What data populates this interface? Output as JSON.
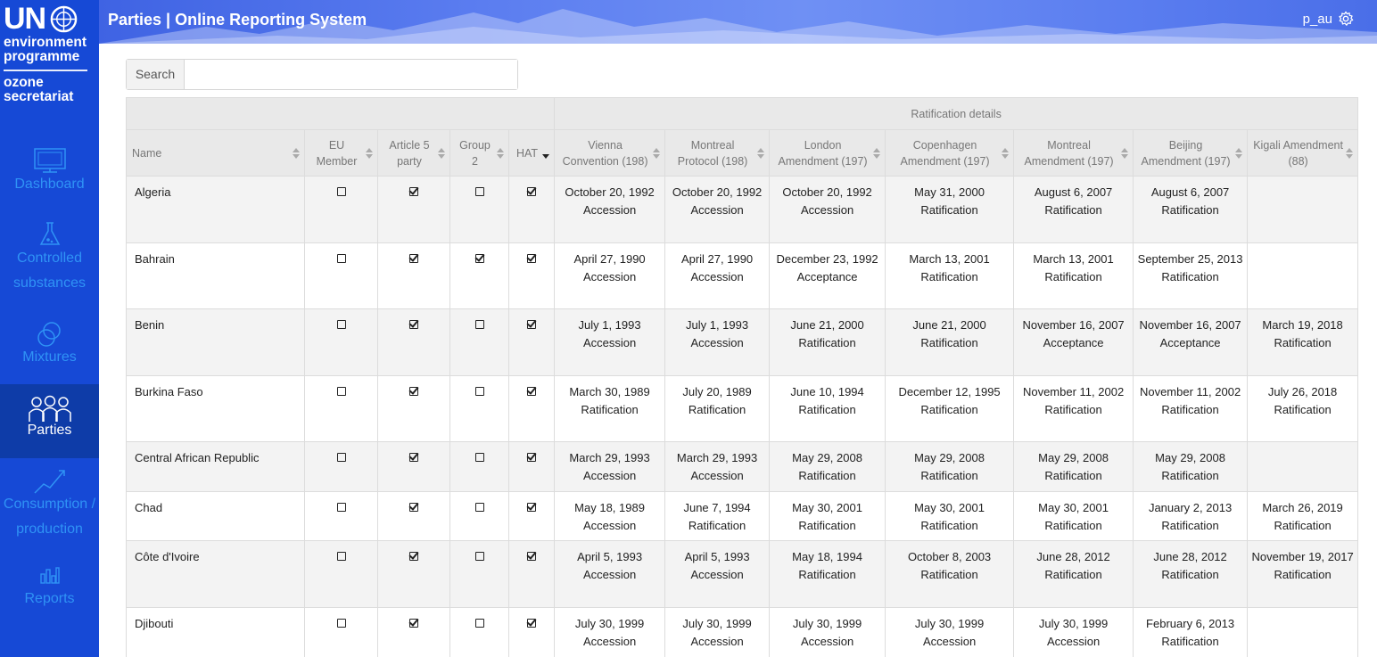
{
  "app": {
    "title": "Parties | Online Reporting System",
    "user": "p_au"
  },
  "logo": {
    "un": "UN",
    "line1": "environment",
    "line2": "programme",
    "line3": "ozone",
    "line4": "secretariat"
  },
  "sidebar": {
    "items": [
      {
        "label": "Dashboard",
        "icon": "monitor-icon",
        "active": false
      },
      {
        "label": "Controlled substances",
        "icon": "flask-icon",
        "active": false
      },
      {
        "label": "Mixtures",
        "icon": "circles-icon",
        "active": false
      },
      {
        "label": "Parties",
        "icon": "people-icon",
        "active": true
      },
      {
        "label": "Consumption / production",
        "icon": "line-chart-icon",
        "active": false
      },
      {
        "label": "Reports",
        "icon": "bar-chart-icon",
        "active": false
      }
    ]
  },
  "search": {
    "label": "Search",
    "value": "",
    "placeholder": ""
  },
  "table": {
    "group_header": "Ratification details",
    "columns": [
      "Name",
      "EU Member",
      "Article 5 party",
      "Group 2",
      "HAT",
      "Vienna Convention (198)",
      "Montreal Protocol (198)",
      "London Amendment (197)",
      "Copenhagen Amendment (197)",
      "Montreal Amendment (197)",
      "Beijing Amendment (197)",
      "Kigali Amendment (88)"
    ],
    "rows": [
      {
        "name": "Algeria",
        "eu": false,
        "art5": true,
        "group2": false,
        "hat": true,
        "ratifications": [
          [
            "October 20, 1992",
            "Accession"
          ],
          [
            "October 20, 1992",
            "Accession"
          ],
          [
            "October 20, 1992",
            "Accession"
          ],
          [
            "May 31, 2000",
            "Ratification"
          ],
          [
            "August 6, 2007",
            "Ratification"
          ],
          [
            "August 6, 2007",
            "Ratification"
          ],
          [
            "",
            ""
          ]
        ]
      },
      {
        "name": "Bahrain",
        "eu": false,
        "art5": true,
        "group2": true,
        "hat": true,
        "ratifications": [
          [
            "April 27, 1990",
            "Accession"
          ],
          [
            "April 27, 1990",
            "Accession"
          ],
          [
            "December 23, 1992",
            "Acceptance"
          ],
          [
            "March 13, 2001",
            "Ratification"
          ],
          [
            "March 13, 2001",
            "Ratification"
          ],
          [
            "September 25, 2013",
            "Ratification"
          ],
          [
            "",
            ""
          ]
        ]
      },
      {
        "name": "Benin",
        "eu": false,
        "art5": true,
        "group2": false,
        "hat": true,
        "ratifications": [
          [
            "July 1, 1993",
            "Accession"
          ],
          [
            "July 1, 1993",
            "Accession"
          ],
          [
            "June 21, 2000",
            "Ratification"
          ],
          [
            "June 21, 2000",
            "Ratification"
          ],
          [
            "November 16, 2007",
            "Acceptance"
          ],
          [
            "November 16, 2007",
            "Acceptance"
          ],
          [
            "March 19, 2018",
            "Ratification"
          ]
        ]
      },
      {
        "name": "Burkina Faso",
        "eu": false,
        "art5": true,
        "group2": false,
        "hat": true,
        "ratifications": [
          [
            "March 30, 1989",
            "Ratification"
          ],
          [
            "July 20, 1989",
            "Ratification"
          ],
          [
            "June 10, 1994",
            "Ratification"
          ],
          [
            "December 12, 1995",
            "Ratification"
          ],
          [
            "November 11, 2002",
            "Ratification"
          ],
          [
            "November 11, 2002",
            "Ratification"
          ],
          [
            "July 26, 2018",
            "Ratification"
          ]
        ]
      },
      {
        "name": "Central African Republic",
        "eu": false,
        "art5": true,
        "group2": false,
        "hat": true,
        "ratifications": [
          [
            "March 29, 1993",
            "Accession"
          ],
          [
            "March 29, 1993",
            "Accession"
          ],
          [
            "May 29, 2008",
            "Ratification"
          ],
          [
            "May 29, 2008",
            "Ratification"
          ],
          [
            "May 29, 2008",
            "Ratification"
          ],
          [
            "May 29, 2008",
            "Ratification"
          ],
          [
            "",
            ""
          ]
        ]
      },
      {
        "name": "Chad",
        "eu": false,
        "art5": true,
        "group2": false,
        "hat": true,
        "ratifications": [
          [
            "May 18, 1989",
            "Accession"
          ],
          [
            "June 7, 1994",
            "Ratification"
          ],
          [
            "May 30, 2001",
            "Ratification"
          ],
          [
            "May 30, 2001",
            "Ratification"
          ],
          [
            "May 30, 2001",
            "Ratification"
          ],
          [
            "January 2, 2013",
            "Ratification"
          ],
          [
            "March 26, 2019",
            "Ratification"
          ]
        ]
      },
      {
        "name": "Côte d'Ivoire",
        "eu": false,
        "art5": true,
        "group2": false,
        "hat": true,
        "ratifications": [
          [
            "April 5, 1993",
            "Accession"
          ],
          [
            "April 5, 1993",
            "Accession"
          ],
          [
            "May 18, 1994",
            "Ratification"
          ],
          [
            "October 8, 2003",
            "Ratification"
          ],
          [
            "June 28, 2012",
            "Ratification"
          ],
          [
            "June 28, 2012",
            "Ratification"
          ],
          [
            "November 19, 2017",
            "Ratification"
          ]
        ]
      },
      {
        "name": "Djibouti",
        "eu": false,
        "art5": true,
        "group2": false,
        "hat": true,
        "ratifications": [
          [
            "July 30, 1999",
            "Accession"
          ],
          [
            "July 30, 1999",
            "Accession"
          ],
          [
            "July 30, 1999",
            "Accession"
          ],
          [
            "July 30, 1999",
            "Accession"
          ],
          [
            "July 30, 1999",
            "Accession"
          ],
          [
            "February 6, 2013",
            "Ratification"
          ],
          [
            "",
            ""
          ]
        ]
      }
    ]
  },
  "colors": {
    "sidebar_bg": "#1649d6",
    "sidebar_active": "#0e3ca8",
    "sidebar_text": "#2f93f5",
    "header": "#5b7df0",
    "table_header_bg": "#e9e9e9"
  }
}
